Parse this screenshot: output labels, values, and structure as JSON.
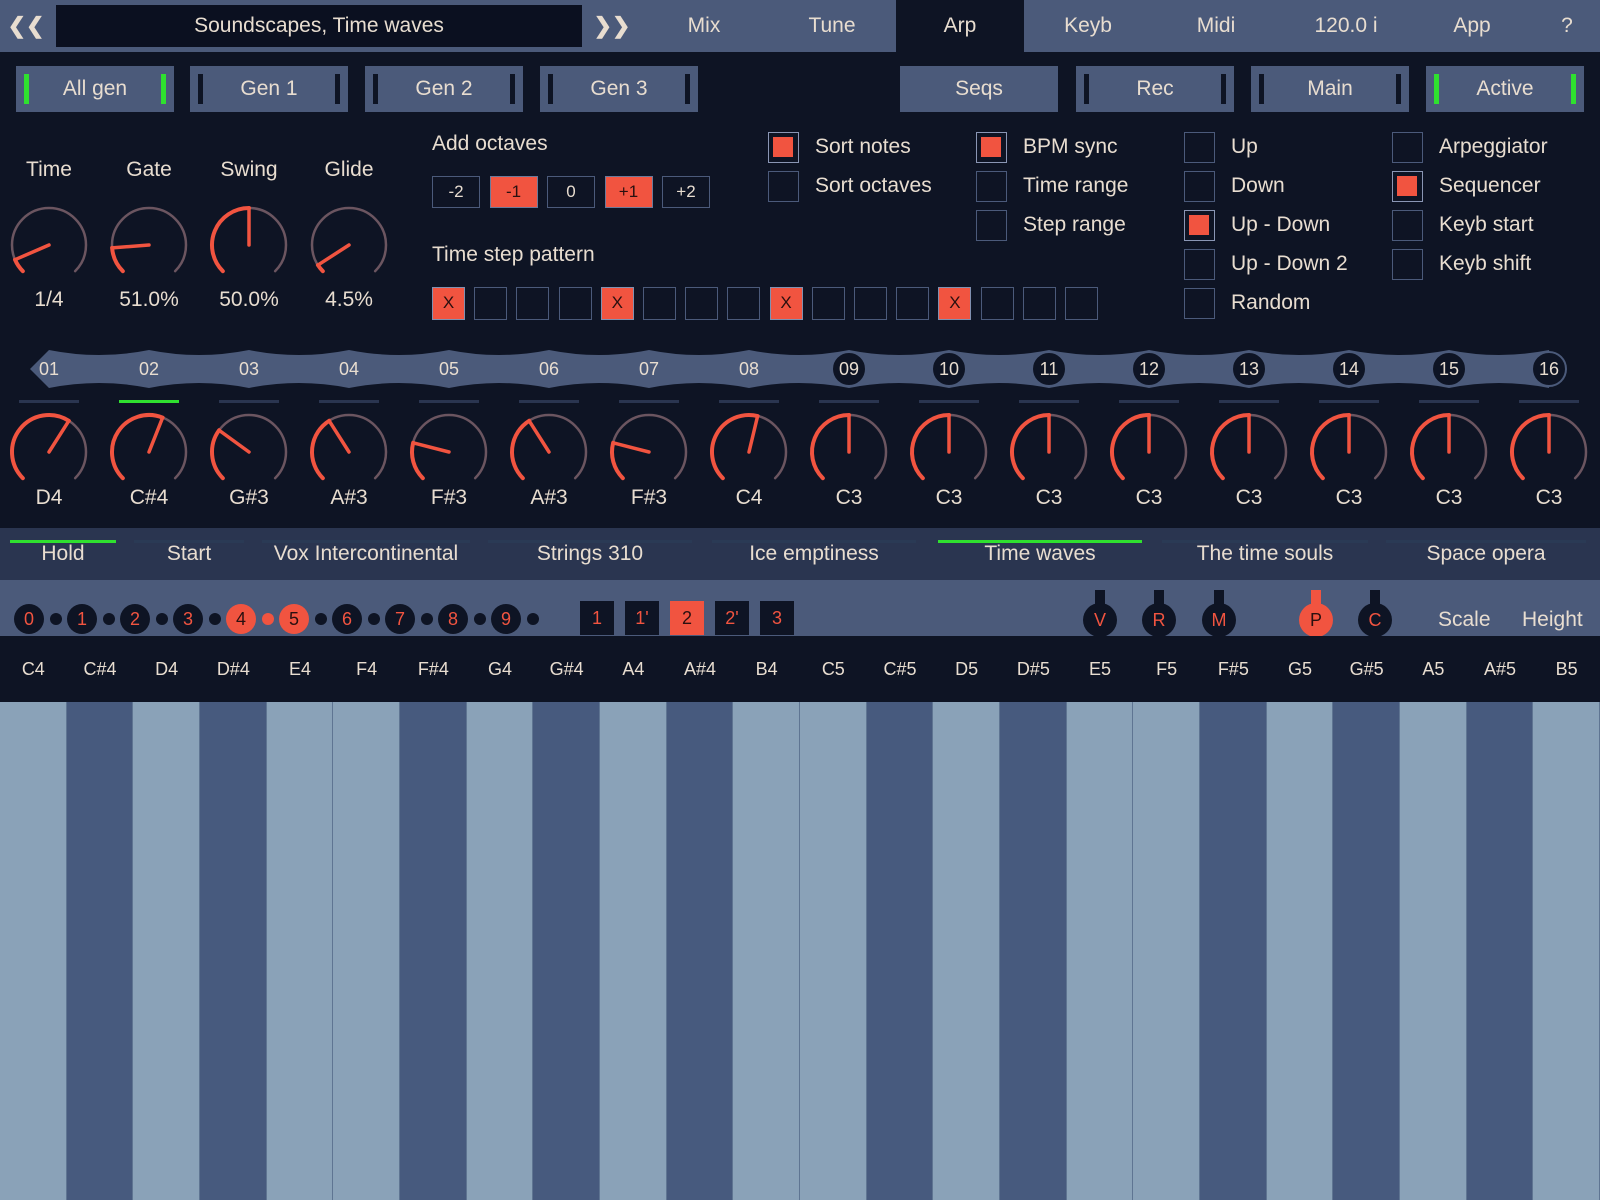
{
  "topbar": {
    "prev_arrow": "❮❮",
    "next_arrow": "❯❯",
    "preset_name": "Soundscapes, Time waves",
    "tabs": [
      {
        "label": "Mix",
        "active": false
      },
      {
        "label": "Tune",
        "active": false
      },
      {
        "label": "Arp",
        "active": true
      },
      {
        "label": "Keyb",
        "active": false
      },
      {
        "label": "Midi",
        "active": false
      },
      {
        "label": "120.0 i",
        "active": false
      },
      {
        "label": "App",
        "active": false
      },
      {
        "label": "?",
        "active": false
      }
    ]
  },
  "gen_buttons": [
    {
      "label": "All gen",
      "on": true
    },
    {
      "label": "Gen 1",
      "on": false
    },
    {
      "label": "Gen 2",
      "on": false
    },
    {
      "label": "Gen 3",
      "on": false
    }
  ],
  "right_buttons": [
    {
      "label": "Seqs",
      "bars": false,
      "on": false
    },
    {
      "label": "Rec",
      "bars": true,
      "on": false
    },
    {
      "label": "Main",
      "bars": true,
      "on": false
    },
    {
      "label": "Active",
      "bars": true,
      "on": true
    }
  ],
  "knobs": [
    {
      "label": "Time",
      "value": "1/4",
      "level": 0.08
    },
    {
      "label": "Gate",
      "value": "51.0%",
      "level": 0.15
    },
    {
      "label": "Swing",
      "value": "50.0%",
      "level": 0.5
    },
    {
      "label": "Glide",
      "value": "4.5%",
      "level": 0.045
    }
  ],
  "add_octaves": {
    "label": "Add octaves",
    "options": [
      {
        "label": "-2",
        "on": false
      },
      {
        "label": "-1",
        "on": true
      },
      {
        "label": "0",
        "on": false
      },
      {
        "label": "+1",
        "on": true
      },
      {
        "label": "+2",
        "on": false
      }
    ]
  },
  "time_step_pattern": {
    "label": "Time step pattern",
    "mark": "X",
    "steps": [
      true,
      false,
      false,
      false,
      true,
      false,
      false,
      false,
      true,
      false,
      false,
      false,
      true,
      false,
      false,
      false
    ]
  },
  "checks_col1": [
    {
      "label": "Sort notes",
      "on": true
    },
    {
      "label": "Sort octaves",
      "on": false
    }
  ],
  "checks_col2": [
    {
      "label": "BPM sync",
      "on": true
    },
    {
      "label": "Time range",
      "on": false
    },
    {
      "label": "Step range",
      "on": false
    }
  ],
  "checks_col3": [
    {
      "label": "Up",
      "on": false
    },
    {
      "label": "Down",
      "on": false
    },
    {
      "label": "Up - Down",
      "on": true
    },
    {
      "label": "Up - Down 2",
      "on": false
    },
    {
      "label": "Random",
      "on": false
    }
  ],
  "checks_col4": [
    {
      "label": "Arpeggiator",
      "on": false
    },
    {
      "label": "Sequencer",
      "on": true
    },
    {
      "label": "Keyb start",
      "on": false
    },
    {
      "label": "Keyb shift",
      "on": false
    }
  ],
  "steps": {
    "numbers": [
      "01",
      "02",
      "03",
      "04",
      "05",
      "06",
      "07",
      "08",
      "09",
      "10",
      "11",
      "12",
      "13",
      "14",
      "15",
      "16"
    ],
    "active_count": 8,
    "current_index": 1,
    "notes": [
      "D4",
      "C#4",
      "G#3",
      "A#3",
      "F#3",
      "A#3",
      "F#3",
      "C4",
      "C3",
      "C3",
      "C3",
      "C3",
      "C3",
      "C3",
      "C3",
      "C3"
    ],
    "levels": [
      0.62,
      0.58,
      0.3,
      0.38,
      0.22,
      0.38,
      0.22,
      0.55,
      0.5,
      0.5,
      0.5,
      0.5,
      0.5,
      0.5,
      0.5,
      0.5
    ]
  },
  "preset_strip": [
    {
      "label": "Hold",
      "on": true
    },
    {
      "label": "Start",
      "on": false
    },
    {
      "label": "Vox Intercontinental",
      "on": false
    },
    {
      "label": "Strings 310",
      "on": false
    },
    {
      "label": "Ice emptiness",
      "on": false
    },
    {
      "label": "Time waves",
      "on": true
    },
    {
      "label": "The time souls",
      "on": false
    },
    {
      "label": "Space opera",
      "on": false
    }
  ],
  "octave_dots": {
    "labels": [
      "0",
      "1",
      "2",
      "3",
      "4",
      "5",
      "6",
      "7",
      "8",
      "9"
    ],
    "selected": [
      "4",
      "5"
    ]
  },
  "range_buttons": [
    {
      "label": "1",
      "on": false
    },
    {
      "label": "1'",
      "on": false
    },
    {
      "label": "2",
      "on": true
    },
    {
      "label": "2'",
      "on": false
    },
    {
      "label": "3",
      "on": false
    }
  ],
  "rod_buttons": [
    {
      "label": "V",
      "on": false
    },
    {
      "label": "R",
      "on": false
    },
    {
      "label": "M",
      "on": false
    },
    {
      "label": "P",
      "on": true
    },
    {
      "label": "C",
      "on": false
    }
  ],
  "ctrl_labels": {
    "scale": "Scale",
    "height": "Height"
  },
  "keyboard": {
    "keys": [
      {
        "label": "C4",
        "color": "white"
      },
      {
        "label": "C#4",
        "color": "black"
      },
      {
        "label": "D4",
        "color": "white"
      },
      {
        "label": "D#4",
        "color": "black"
      },
      {
        "label": "E4",
        "color": "white"
      },
      {
        "label": "F4",
        "color": "white"
      },
      {
        "label": "F#4",
        "color": "black"
      },
      {
        "label": "G4",
        "color": "white"
      },
      {
        "label": "G#4",
        "color": "black"
      },
      {
        "label": "A4",
        "color": "white"
      },
      {
        "label": "A#4",
        "color": "black"
      },
      {
        "label": "B4",
        "color": "white"
      },
      {
        "label": "C5",
        "color": "white"
      },
      {
        "label": "C#5",
        "color": "black"
      },
      {
        "label": "D5",
        "color": "white"
      },
      {
        "label": "D#5",
        "color": "black"
      },
      {
        "label": "E5",
        "color": "white"
      },
      {
        "label": "F5",
        "color": "white"
      },
      {
        "label": "F#5",
        "color": "black"
      },
      {
        "label": "G5",
        "color": "white"
      },
      {
        "label": "G#5",
        "color": "black"
      },
      {
        "label": "A5",
        "color": "white"
      },
      {
        "label": "A#5",
        "color": "black"
      },
      {
        "label": "B5",
        "color": "white"
      }
    ]
  },
  "colors": {
    "accent": "#f15440",
    "active_green": "#2fe02f",
    "panel": "#4b5a7a",
    "background": "#0e1424",
    "knob_track": "#6b5560"
  }
}
